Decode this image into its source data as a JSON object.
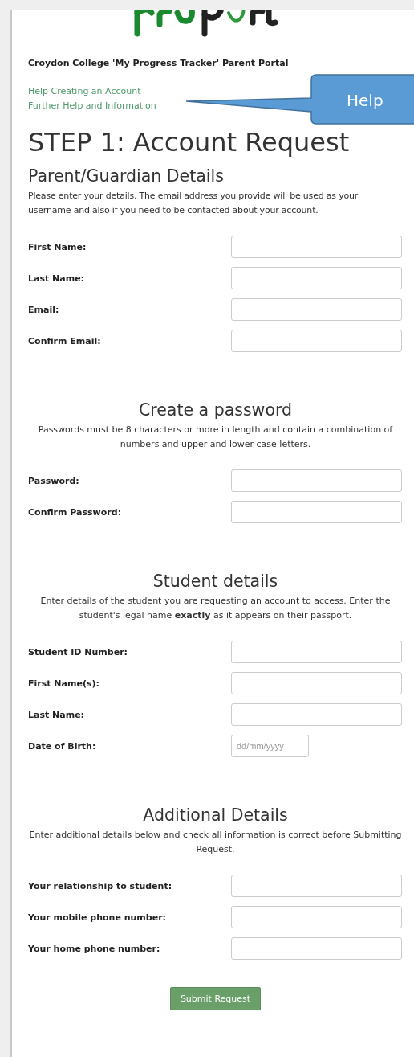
{
  "header": {
    "title": "Croydon College 'My Progress Tracker' Parent Portal",
    "links": [
      "Help Creating an Account",
      "Further Help and Information"
    ]
  },
  "callout": {
    "text": "Help"
  },
  "heading": "STEP 1: Account Request",
  "sections": [
    {
      "title": "Parent/Guardian Details",
      "kind": "plain",
      "intro": "Please enter your details. The email address you provide will be used as your username and also if you need to be contacted about your account.",
      "fields": [
        {
          "label": "First Name:",
          "kind": "text"
        },
        {
          "label": "Last Name:",
          "kind": "text"
        },
        {
          "label": "Email:",
          "kind": "text"
        },
        {
          "label": "Confirm Email:",
          "kind": "text"
        }
      ]
    },
    {
      "title": "Create a password",
      "kind": "centered",
      "intro": "Passwords must be 8 characters or more in length and contain a combination of numbers and upper and lower case letters.",
      "fields": [
        {
          "label": "Password:",
          "kind": "text"
        },
        {
          "label": "Confirm Password:",
          "kind": "text"
        }
      ]
    },
    {
      "title": "Student details",
      "kind": "centered",
      "intro": "Enter details of the student you are requesting an account to access. Enter the student's legal name **exactly** as it appears on their passport.",
      "fields": [
        {
          "label": "Student ID Number:",
          "kind": "text"
        },
        {
          "label": "First Name(s):",
          "kind": "text"
        },
        {
          "label": "Last Name:",
          "kind": "text"
        },
        {
          "label": "Date of Birth:",
          "kind": "date",
          "placeholder": "dd/mm/yyyy"
        }
      ]
    },
    {
      "title": "Additional Details",
      "kind": "centered",
      "intro": "Enter additional details below and check all information is correct before Submitting Request.",
      "fields": [
        {
          "label": "Your relationship to student:",
          "kind": "text"
        },
        {
          "label": "Your mobile phone number:",
          "kind": "text"
        },
        {
          "label": "Your home phone number:",
          "kind": "text"
        }
      ]
    }
  ],
  "submit": "Submit Request"
}
